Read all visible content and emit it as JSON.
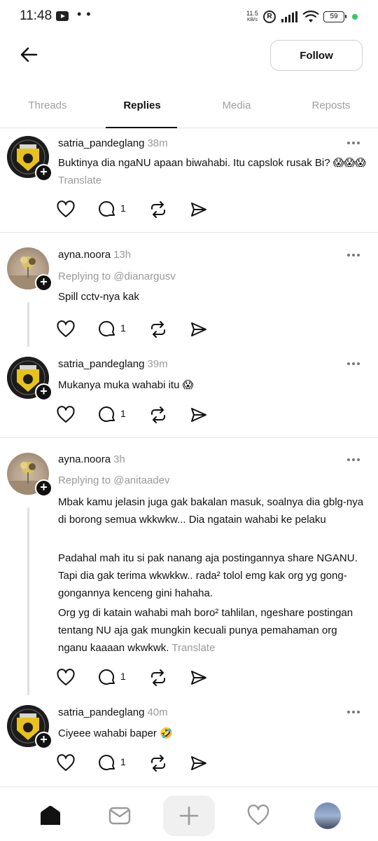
{
  "status_bar": {
    "time": "11:48",
    "dots": "• •",
    "speed_value": "11.5",
    "speed_unit": "KB/s",
    "r_badge": "R",
    "battery": "59"
  },
  "header": {
    "follow_label": "Follow"
  },
  "tabs": [
    {
      "label": "Threads",
      "active": false
    },
    {
      "label": "Replies",
      "active": true
    },
    {
      "label": "Media",
      "active": false
    },
    {
      "label": "Reposts",
      "active": false
    }
  ],
  "posts": [
    {
      "username": "satria_pandeglang",
      "time": "38m",
      "text": "Buktinya dia ngaNU apaan biwahabi. Itu capslok rusak Bi? 😱😱😱",
      "translate": "Translate",
      "reply_count": "1"
    },
    {
      "username": "ayna.noora",
      "time": "13h",
      "replying_to": "Replying to @dianargusv",
      "text": "Spill cctv-nya kak",
      "reply_count": "1"
    },
    {
      "username": "satria_pandeglang",
      "time": "39m",
      "text": "Mukanya muka wahabi itu 😱",
      "reply_count": "1"
    },
    {
      "username": "ayna.noora",
      "time": "3h",
      "replying_to": "Replying to @anitaadev",
      "paragraphs": [
        "Mbak kamu jelasin juga gak bakalan masuk, soalnya dia gblg-nya di borong semua wkkwkw... Dia ngatain wahabi ke pelaku",
        "Padahal mah itu si pak nanang aja postingannya share NGANU. Tapi dia gak terima wkwkkw.. rada² tolol emg kak org yg gong-gongannya kenceng gini hahaha.",
        "Org yg di katain wahabi mah boro² tahlilan, ngeshare postingan tentang NU aja gak mungkin kecuali punya pemahaman org nganu kaaaan wkwkwk."
      ],
      "translate": "Translate",
      "reply_count": "1"
    },
    {
      "username": "satria_pandeglang",
      "time": "40m",
      "text": "Ciyeee wahabi baper 🤣",
      "reply_count": "1"
    }
  ]
}
